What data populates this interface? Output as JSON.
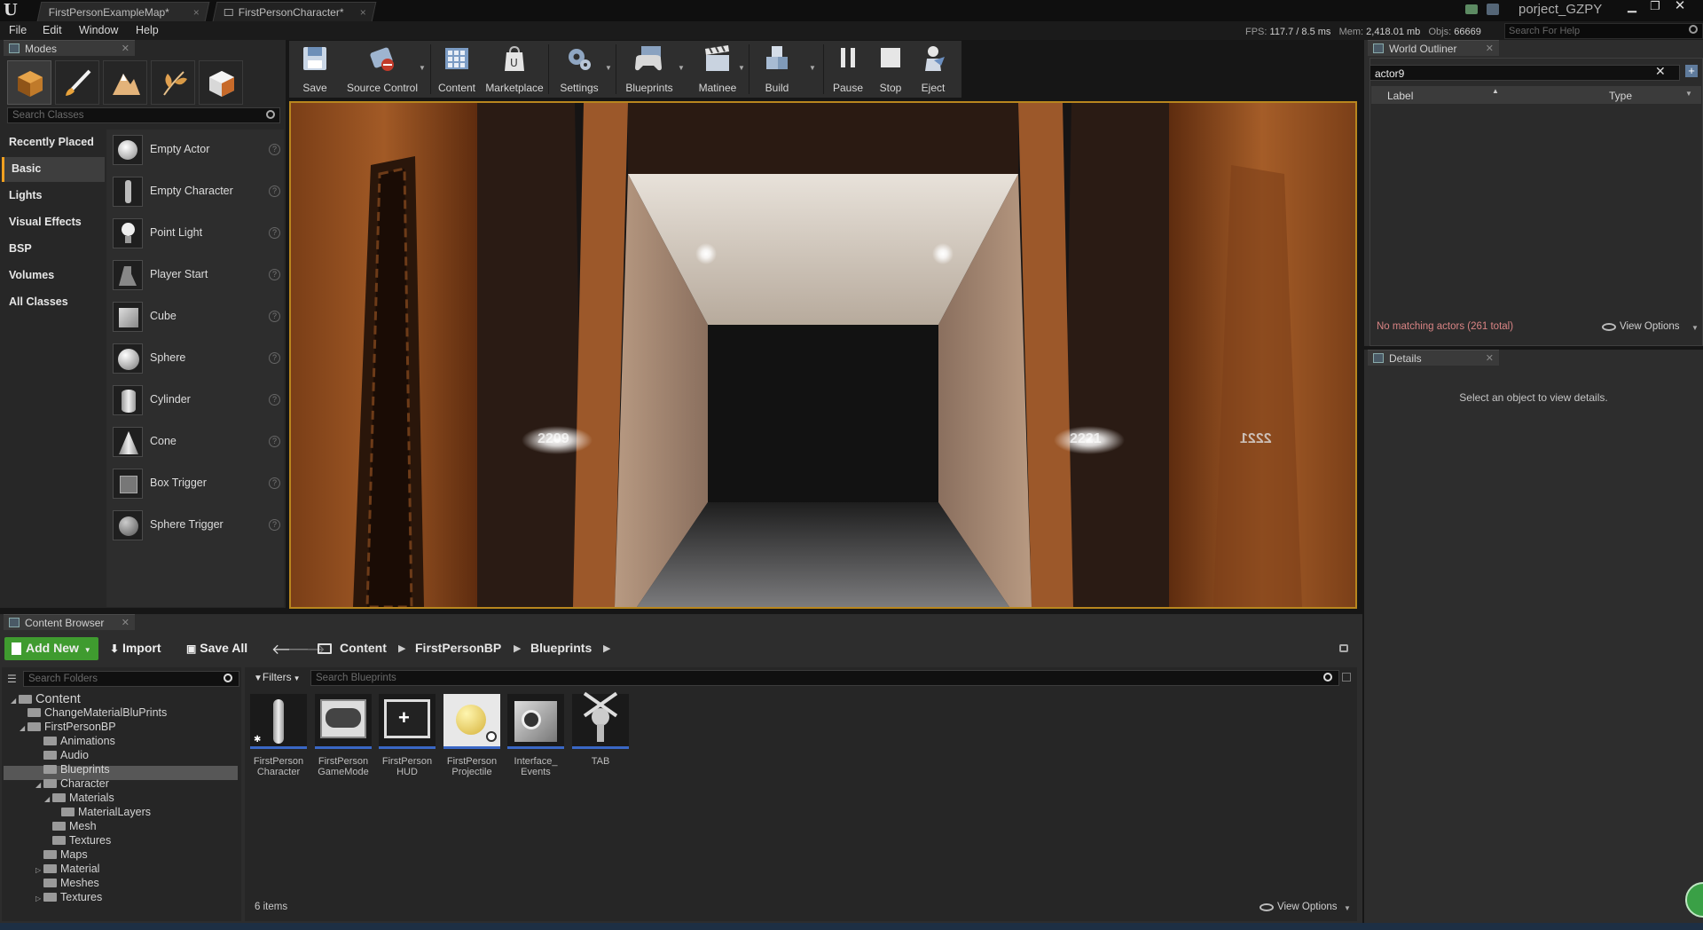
{
  "titlebar": {
    "tabs": [
      "FirstPersonExampleMap*",
      "FirstPersonCharacter*"
    ],
    "project": "porject_GZPY"
  },
  "menu": {
    "items": [
      "File",
      "Edit",
      "Window",
      "Help"
    ]
  },
  "stats": {
    "fps_label": "FPS:",
    "fps": "117.7 / 8.5 ms",
    "mem_label": "Mem:",
    "mem": "2,418.01 mb",
    "objs_label": "Objs:",
    "objs": "66669"
  },
  "help_search": {
    "placeholder": "Search For Help"
  },
  "modes": {
    "tab": "Modes",
    "buttons": [
      "place-mode",
      "paint-mode",
      "landscape-mode",
      "foliage-mode",
      "geometry-mode"
    ],
    "search_placeholder": "Search Classes",
    "categories": [
      "Recently Placed",
      "Basic",
      "Lights",
      "Visual Effects",
      "BSP",
      "Volumes",
      "All Classes"
    ],
    "selected_category": "Basic",
    "items": [
      "Empty Actor",
      "Empty Character",
      "Point Light",
      "Player Start",
      "Cube",
      "Sphere",
      "Cylinder",
      "Cone",
      "Box Trigger",
      "Sphere Trigger"
    ]
  },
  "toolbar": {
    "save": "Save",
    "source_control": "Source Control",
    "content": "Content",
    "marketplace": "Marketplace",
    "settings": "Settings",
    "blueprints": "Blueprints",
    "matinee": "Matinee",
    "build": "Build",
    "pause": "Pause",
    "stop": "Stop",
    "eject": "Eject"
  },
  "viewport": {
    "door_numbers": [
      "2209",
      "2221",
      "2221"
    ]
  },
  "outliner": {
    "tab": "World Outliner",
    "search_value": "actor9",
    "col_label": "Label",
    "col_type": "Type",
    "status": "No matching actors (261 total)",
    "view_options": "View Options"
  },
  "details": {
    "tab": "Details",
    "empty_text": "Select an object to view details."
  },
  "content_browser": {
    "tab": "Content Browser",
    "add_new": "Add New",
    "import": "Import",
    "save_all": "Save All",
    "breadcrumb": [
      "Content",
      "FirstPersonBP",
      "Blueprints"
    ],
    "search_folders_placeholder": "Search Folders",
    "filters": "Filters",
    "search_assets_placeholder": "Search Blueprints",
    "tree": [
      {
        "label": "Content",
        "depth": 0,
        "expanded": true
      },
      {
        "label": "ChangeMaterialBluPrints",
        "depth": 1
      },
      {
        "label": "FirstPersonBP",
        "depth": 1,
        "expanded": true
      },
      {
        "label": "Animations",
        "depth": 2
      },
      {
        "label": "Audio",
        "depth": 2
      },
      {
        "label": "Blueprints",
        "depth": 2,
        "selected": true
      },
      {
        "label": "Character",
        "depth": 2,
        "expanded": true
      },
      {
        "label": "Materials",
        "depth": 3,
        "expanded": true
      },
      {
        "label": "MaterialLayers",
        "depth": 4
      },
      {
        "label": "Mesh",
        "depth": 3
      },
      {
        "label": "Textures",
        "depth": 3
      },
      {
        "label": "Maps",
        "depth": 2
      },
      {
        "label": "Material",
        "depth": 2,
        "collapsed": true
      },
      {
        "label": "Meshes",
        "depth": 2
      },
      {
        "label": "Textures",
        "depth": 2,
        "collapsed": true
      }
    ],
    "assets": [
      {
        "line1": "FirstPerson",
        "line2": "Character"
      },
      {
        "line1": "FirstPerson",
        "line2": "GameMode"
      },
      {
        "line1": "FirstPerson",
        "line2": "HUD"
      },
      {
        "line1": "FirstPerson",
        "line2": "Projectile"
      },
      {
        "line1": "Interface_",
        "line2": "Events"
      },
      {
        "line1": "TAB",
        "line2": ""
      }
    ],
    "item_count": "6 items",
    "view_options": "View Options"
  },
  "colors": {
    "accent": "#f0a020",
    "add_new": "#3f9b2f",
    "asset_underline": "#3a67c5",
    "status_red": "#d98484"
  }
}
